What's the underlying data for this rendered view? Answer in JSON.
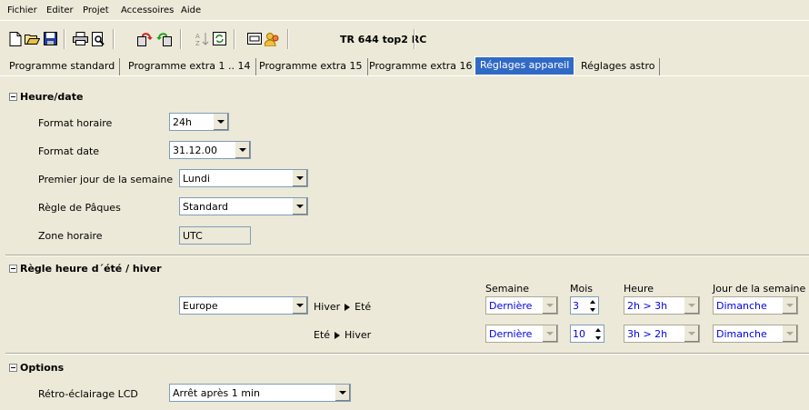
{
  "menu": [
    "Fichier",
    "Editer",
    "Projet",
    "Accessoires",
    "Aide"
  ],
  "toolbar": {
    "device_name": "TR 644 top2 RC",
    "icons": [
      "new-file-icon",
      "open-folder-icon",
      "save-icon",
      "print-icon",
      "print-preview-icon",
      "transfer-to-device-icon",
      "read-from-device-icon",
      "sort-icon",
      "refresh-icon",
      "window-icon",
      "user-icon"
    ]
  },
  "tabs": [
    {
      "label": "Programme standard"
    },
    {
      "label": "Programme extra 1 .. 14"
    },
    {
      "label": "Programme extra 15"
    },
    {
      "label": "Programme extra 16"
    },
    {
      "label": "Réglages appareil",
      "active": true
    },
    {
      "label": "Réglages astro"
    }
  ],
  "heure_date": {
    "title": "Heure/date",
    "format_horaire": {
      "label": "Format horaire",
      "value": "24h"
    },
    "format_date": {
      "label": "Format date",
      "value": "31.12.00"
    },
    "premier_jour": {
      "label": "Premier jour de la semaine",
      "value": "Lundi"
    },
    "regle_paques": {
      "label": "Règle de Pâques",
      "value": "Standard"
    },
    "zone_horaire": {
      "label": "Zone horaire",
      "value": "UTC"
    }
  },
  "ete_hiver": {
    "title": "Règle heure d´été / hiver",
    "region": "Europe",
    "col_semaine": "Semaine",
    "col_mois": "Mois",
    "col_heure": "Heure",
    "col_jour": "Jour de la semaine",
    "row1": {
      "from": "Hiver",
      "to": "Eté",
      "semaine": "Dernière",
      "mois": "3",
      "heure": "2h > 3h",
      "jour": "Dimanche"
    },
    "row2": {
      "from": "Eté",
      "to": "Hiver",
      "semaine": "Dernière",
      "mois": "10",
      "heure": "3h > 2h",
      "jour": "Dimanche"
    }
  },
  "options": {
    "title": "Options",
    "retro": {
      "label": "Rétro-éclairage LCD",
      "value": "Arrêt après 1 min"
    }
  }
}
